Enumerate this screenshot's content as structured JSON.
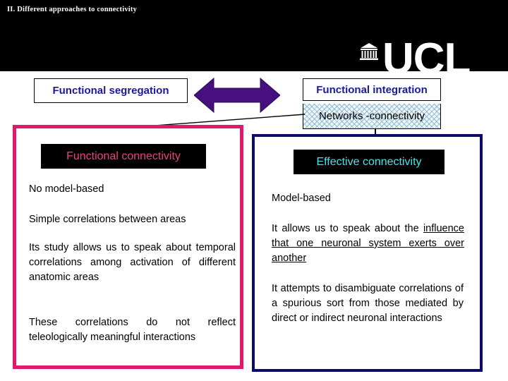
{
  "slide": {
    "title": "II. Different approaches to connectivity"
  },
  "logo": {
    "wordmark": "UCL",
    "icon": "ucl-portico-building-icon"
  },
  "top_row": {
    "segregation_label": "Functional segregation",
    "integration_label": "Functional integration",
    "networks_label": "Networks -connectivity",
    "arrow_icon": "double-headed-arrow-icon"
  },
  "functional_panel": {
    "banner_label": "Functional connectivity",
    "paragraphs": [
      "No model-based",
      "Simple correlations between areas",
      "Its study allows us to speak about temporal correlations among activation of different anatomic areas",
      "These correlations do not reflect teleologically meaningful interactions"
    ]
  },
  "effective_panel": {
    "banner_label": "Effective connectivity",
    "paragraphs": [
      "Model-based"
    ],
    "influence_lead": "It allows us to speak about the ",
    "influence_underlined": "influence that one neuronal system exerts over another",
    "last_paragraph": "It attempts to disambiguate correlations of a spurious sort from those mediated by direct or indirect neuronal interactions"
  },
  "colors": {
    "header_band": "#000000",
    "heading_blue": "#1a199e",
    "purple_arrow": "#46107e",
    "pink_border": "#e0196e",
    "navy_border": "#0a0a6e",
    "functional_banner_text": "#f0407a",
    "effective_banner_text": "#44e8e8",
    "hatch_blue": "#78aac3"
  }
}
